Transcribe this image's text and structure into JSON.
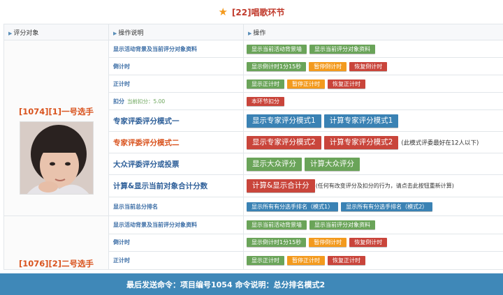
{
  "header": {
    "title": "[22]唱歌环节",
    "icon": "star-icon"
  },
  "columns": [
    "评分对象",
    "操作说明",
    "操作"
  ],
  "contestants": [
    {
      "name": "[1074][1]一号选手",
      "rows": [
        {
          "desc": "显示活动背景及当前评分对象资料",
          "buttons": [
            "显示当前活动背景墙",
            "显示当前评分对象资料"
          ]
        },
        {
          "desc": "倒计时",
          "buttons": [
            "显示倒计时1分15秒",
            "暂停倒计时",
            "恢复倒计时"
          ]
        },
        {
          "desc": "正计时",
          "buttons": [
            "显示正计时",
            "暂停正计时",
            "恢复正计时"
          ]
        },
        {
          "desc": "扣分",
          "score": "当前扣分：5.00",
          "buttons": [
            "本环节扣分"
          ]
        },
        {
          "desc": "专家评委评分模式一",
          "buttons": [
            "显示专家评分模式1",
            "计算专家评分模式1"
          ]
        },
        {
          "desc": "专家评委评分模式二",
          "buttons": [
            "显示专家评分模式2",
            "计算专家评分模式2"
          ],
          "note": "(此模式评委最好在12人以下)"
        },
        {
          "desc": "大众评委评分或投票",
          "buttons": [
            "显示大众评分",
            "计算大众评分"
          ]
        },
        {
          "desc": "计算&显示当前对象合计分数",
          "buttons": [
            "计算&显示合计分"
          ],
          "note": "(任何有改变评分及扣分的行为，请点击此按钮重新计算)"
        },
        {
          "desc": "显示当前总分排名",
          "buttons": [
            "显示所有有分选手排名（模式1）",
            "显示所有有分选手排名（模式2）"
          ]
        }
      ]
    },
    {
      "name": "[1076][2]二号选手",
      "rows": [
        {
          "desc": "显示活动背景及当前评分对象资料",
          "buttons": [
            "显示当前活动背景墙",
            "显示当前评分对象资料"
          ]
        },
        {
          "desc": "倒计时",
          "buttons": [
            "显示倒计时1分15秒",
            "暂停倒计时",
            "恢复倒计时"
          ]
        },
        {
          "desc": "正计时",
          "buttons": [
            "显示正计时",
            "暂停正计时",
            "恢复正计时"
          ]
        }
      ]
    }
  ],
  "status": {
    "text": "最后发送命令：项目编号1054 命令说明：总分排名模式2"
  },
  "colors": {
    "accent": "#f39a1e",
    "title": "#c0392b",
    "green": "#6aa459",
    "orange": "#f39a1e",
    "red": "#c9453b",
    "blue": "#3a82b4",
    "statusbar": "#3f88b8"
  }
}
